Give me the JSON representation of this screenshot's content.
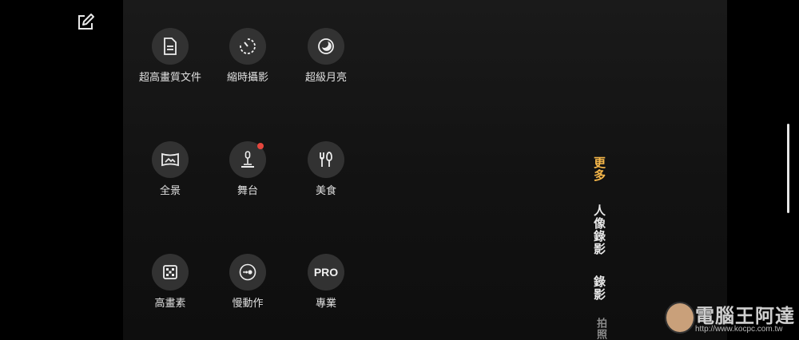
{
  "modes": [
    {
      "id": "document",
      "label": "超高畫質文件",
      "icon": "document-icon"
    },
    {
      "id": "timelapse",
      "label": "縮時攝影",
      "icon": "timelapse-icon"
    },
    {
      "id": "moon",
      "label": "超級月亮",
      "icon": "moon-icon"
    },
    {
      "id": "panorama",
      "label": "全景",
      "icon": "panorama-icon"
    },
    {
      "id": "stage",
      "label": "舞台",
      "icon": "stage-icon",
      "badge": true
    },
    {
      "id": "food",
      "label": "美食",
      "icon": "food-icon"
    },
    {
      "id": "high-res",
      "label": "高畫素",
      "icon": "high-resolution-icon"
    },
    {
      "id": "slow-motion",
      "label": "慢動作",
      "icon": "slow-motion-icon"
    },
    {
      "id": "pro",
      "label": "專業",
      "icon_text": "PRO"
    }
  ],
  "mode_tabs": [
    {
      "id": "more",
      "label": "更多",
      "active": true
    },
    {
      "id": "portrait-video",
      "label": "人像錄影"
    },
    {
      "id": "video",
      "label": "錄影"
    },
    {
      "id": "photo",
      "label": "拍照"
    }
  ],
  "colors": {
    "accent": "#f5b74a",
    "badge": "#e5463d",
    "circle": "#323232"
  },
  "watermark": {
    "text": "電腦王阿達",
    "url": "http://www.kocpc.com.tw"
  }
}
